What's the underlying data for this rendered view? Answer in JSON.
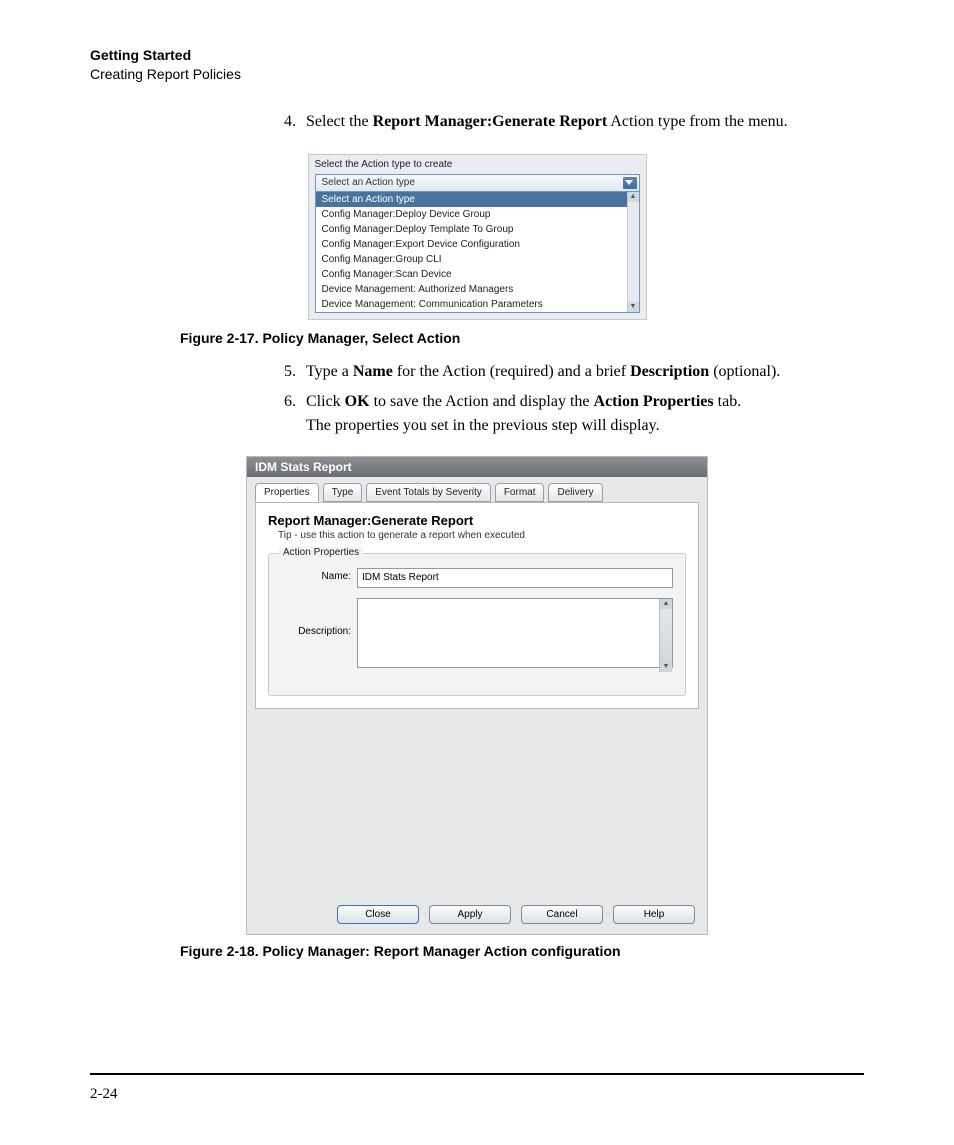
{
  "header": {
    "line1": "Getting Started",
    "line2": "Creating Report Policies"
  },
  "steps": {
    "s4": {
      "num": "4.",
      "pre": "Select the ",
      "bold1": "Report Manager:Generate Report",
      "post": " Action type from the menu."
    },
    "s5": {
      "num": "5.",
      "pre": "Type a ",
      "bold1": "Name",
      "mid": " for the Action (required) and a brief ",
      "bold2": "Description",
      "post": " (optional)."
    },
    "s6": {
      "num": "6.",
      "pre": "Click ",
      "bold1": "OK",
      "mid": " to save the Action and display the ",
      "bold2": "Action Properties",
      "post": " tab.",
      "line2": "The properties you set in the previous step will display."
    }
  },
  "fig17": {
    "label": "Select the Action type to create",
    "selected": "Select an Action type",
    "items": [
      "Select an Action type",
      "Config Manager:Deploy Device Group",
      "Config Manager:Deploy Template To Group",
      "Config Manager:Export Device Configuration",
      "Config Manager:Group CLI",
      "Config Manager:Scan Device",
      "Device Management: Authorized Managers",
      "Device Management: Communication Parameters"
    ],
    "caption": "Figure 2-17. Policy Manager, Select Action"
  },
  "fig18": {
    "title": "IDM Stats Report",
    "tabs": [
      "Properties",
      "Type",
      "Event Totals by Severity",
      "Format",
      "Delivery"
    ],
    "section_title": "Report Manager:Generate Report",
    "tip": "Tip - use this action to generate a report when executed",
    "fieldset_legend": "Action Properties",
    "name_label": "Name:",
    "name_value": "IDM Stats Report",
    "desc_label": "Description:",
    "buttons": {
      "close": "Close",
      "apply": "Apply",
      "cancel": "Cancel",
      "help": "Help"
    },
    "caption": "Figure 2-18. Policy Manager: Report Manager Action configuration"
  },
  "page_number": "2-24"
}
